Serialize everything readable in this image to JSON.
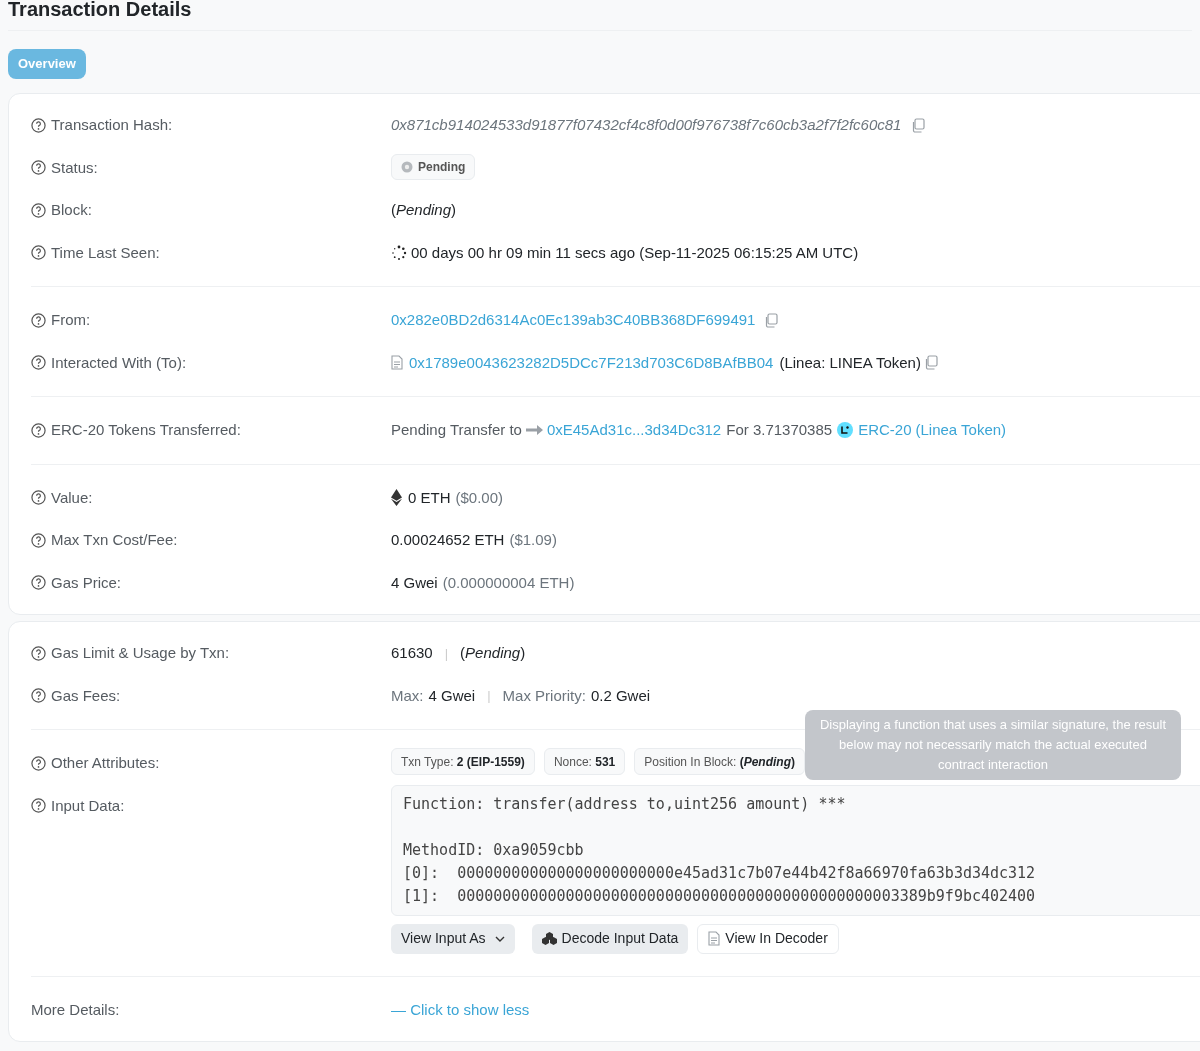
{
  "page_title": "Transaction Details",
  "tabs": [
    {
      "label": "Overview",
      "selected": true
    }
  ],
  "sections": [
    {
      "rows": [
        {
          "kind": "hash",
          "label": "Transaction Hash:",
          "value": "0x871cb914024533d91877f07432cf4c8f0d00f976738f7c60cb3a2f7f2fc60c81"
        },
        {
          "kind": "status",
          "label": "Status:",
          "badge": "Pending"
        },
        {
          "kind": "plain",
          "label": "Block:",
          "parts": [
            {
              "text": "(*Pending*)",
              "kind": "dark"
            }
          ]
        },
        {
          "kind": "time",
          "label": "Time Last Seen:",
          "parts": [
            {
              "text": "00 days 00 hr 09 min 11 secs ago (Sep-11-2025 06:15:25 AM UTC)",
              "kind": "dark"
            }
          ]
        },
        {
          "kind": "divider"
        },
        {
          "kind": "address",
          "label": "From:",
          "link": "0x282e0BD2d6314Ac0Ec139ab3C40BB368DF699491"
        },
        {
          "kind": "contract",
          "label": "Interacted With (To):",
          "link": "0x1789e0043623282D5DCc7F213d703C6D8BAfBB04",
          "name": "(Linea: LINEA Token)"
        },
        {
          "kind": "divider"
        },
        {
          "kind": "transfer",
          "label": "ERC-20 Tokens Transferred:",
          "prefix": "Pending Transfer to",
          "to": "0xE45Ad31c...3d34Dc312",
          "amount": "For 3.71370385",
          "token": "ERC-20",
          "token_name": "(Linea Token)"
        },
        {
          "kind": "divider"
        },
        {
          "kind": "value",
          "label": "Value:",
          "parts": [
            {
              "text": "0 ETH",
              "kind": "dark"
            },
            {
              "text": "($0.00)",
              "kind": "muted"
            }
          ]
        },
        {
          "kind": "plain",
          "label": "Max Txn Cost/Fee:",
          "parts": [
            {
              "text": "0.00024652 ETH",
              "kind": "dark"
            },
            {
              "text": "($1.09)",
              "kind": "muted"
            }
          ]
        },
        {
          "kind": "plain",
          "label": "Gas Price:",
          "parts": [
            {
              "text": "4 Gwei",
              "kind": "dark"
            },
            {
              "text": "(0.000000004 ETH)",
              "kind": "muted"
            }
          ]
        }
      ]
    },
    {
      "rows": [
        {
          "kind": "plain",
          "label": "Gas Limit & Usage by Txn:",
          "parts": [
            {
              "text": "61630",
              "kind": "dark"
            },
            {
              "text": "|",
              "kind": "separator"
            },
            {
              "text": "(*Pending*)",
              "kind": "dark"
            }
          ]
        },
        {
          "kind": "plain",
          "label": "Gas Fees:",
          "parts": [
            {
              "text": "Max:",
              "kind": "muted"
            },
            {
              "text": "4 Gwei",
              "kind": "dark"
            },
            {
              "text": "|",
              "kind": "separator"
            },
            {
              "text": "Max Priority:",
              "kind": "muted"
            },
            {
              "text": "0.2 Gwei",
              "kind": "dark"
            }
          ]
        },
        {
          "kind": "divider"
        },
        {
          "kind": "attributes",
          "label": "Other Attributes:",
          "badges": [
            {
              "name": "Txn Type:",
              "value": "2 (EIP-1559)"
            },
            {
              "name": "Nonce:",
              "value": "531"
            },
            {
              "name": "Position In Block:",
              "value": "(*Pending*)"
            }
          ],
          "tooltip": "Displaying a function that uses a similar signature, the result below may not necessarily match the actual executed contract interaction"
        },
        {
          "kind": "input",
          "label": "Input Data:",
          "function": "Function: transfer(address to,uint256 amount) ***",
          "code": [
            "MethodID: 0xa9059cbb",
            "[0]:  000000000000000000000000e45ad31c7b07e44b42f8a66970fa63b3d34dc312",
            "[1]:  0000000000000000000000000000000000000000000000003389b9f9bc402400"
          ],
          "buttons": [
            {
              "kind": "dropdown",
              "label": "View Input As"
            },
            {
              "kind": "decode",
              "label": "Decode Input Data"
            },
            {
              "kind": "decoder",
              "label": "View In Decoder"
            }
          ]
        },
        {
          "kind": "divider"
        },
        {
          "kind": "more",
          "label": "More Details:",
          "link": "— Click to show less"
        }
      ]
    }
  ]
}
